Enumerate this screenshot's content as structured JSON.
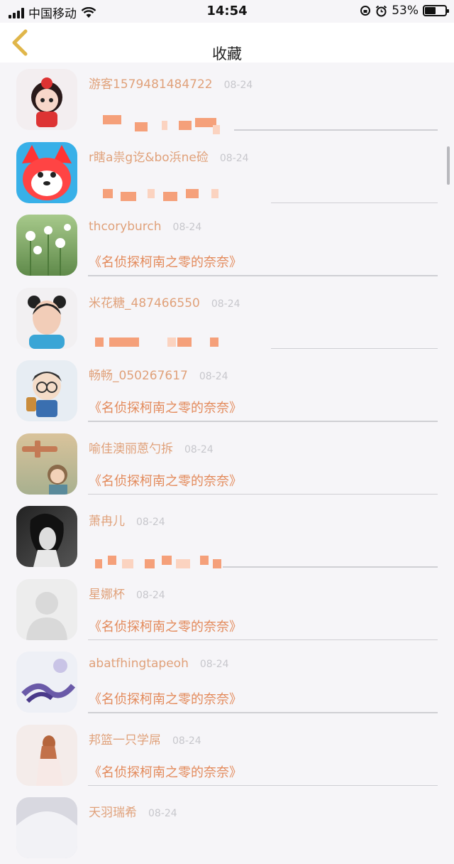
{
  "status": {
    "carrier": "中国移动",
    "time": "14:54",
    "battery": "53%",
    "battery_level": 0.53
  },
  "nav": {
    "title": "收藏"
  },
  "items": [
    {
      "name": "游客1579481484722",
      "date": "08-24",
      "content": "",
      "obscured": true
    },
    {
      "name": "r瞎a祟g讫&bo浜ne硷",
      "date": "08-24",
      "content": "",
      "obscured": true
    },
    {
      "name": "thcoryburch",
      "date": "08-24",
      "content": "《名侦探柯南之零的奈奈》",
      "obscured": false
    },
    {
      "name": "米花糖_487466550",
      "date": "08-24",
      "content": "",
      "obscured": true
    },
    {
      "name": "畅畅_050267617",
      "date": "08-24",
      "content": "《名侦探柯南之零的奈奈》",
      "obscured": false
    },
    {
      "name": "喻佳澳丽蒽勺拆",
      "date": "08-24",
      "content": "《名侦探柯南之零的奈奈》",
      "obscured": false
    },
    {
      "name": "萧冉儿",
      "date": "08-24",
      "content": "",
      "obscured": true
    },
    {
      "name": "星娜杯",
      "date": "08-24",
      "content": "《名侦探柯南之零的奈奈》",
      "obscured": false
    },
    {
      "name": "abatfhingtapeoh",
      "date": "08-24",
      "content": "《名侦探柯南之零的奈奈》",
      "obscured": false
    },
    {
      "name": "邦篮一只学屌",
      "date": "08-24",
      "content": "《名侦探柯南之零的奈奈》",
      "obscured": false
    },
    {
      "name": "天羽瑞希",
      "date": "08-24",
      "content": "",
      "obscured": false
    }
  ],
  "colors": {
    "accent": "#e0a17a",
    "content": "#e38a5b",
    "date": "#c7c7cc",
    "back": "#e0b64a"
  }
}
